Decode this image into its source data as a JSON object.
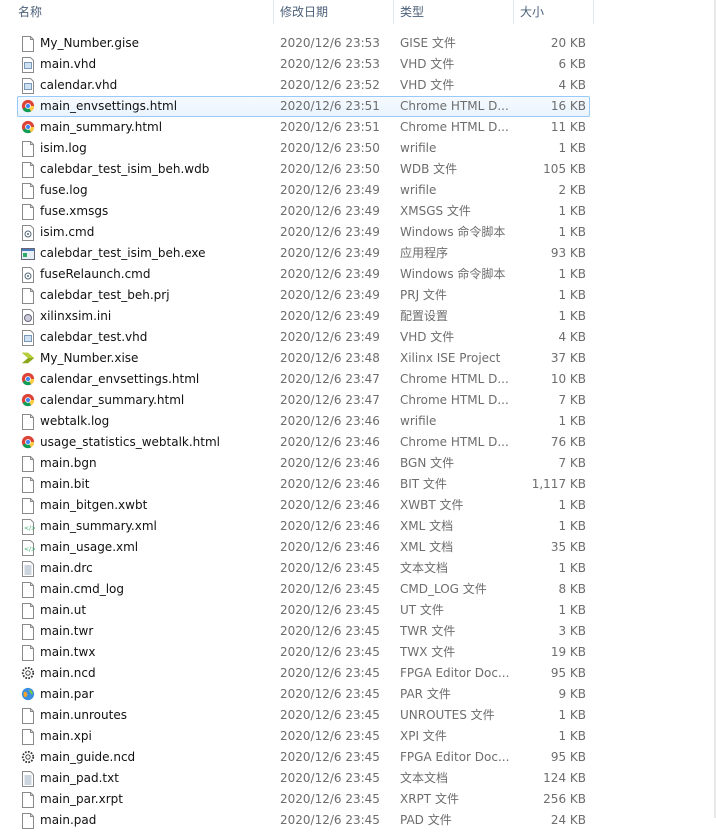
{
  "columns": {
    "name": "名称",
    "date": "修改日期",
    "type": "类型",
    "size": "大小"
  },
  "files": [
    {
      "name": "My_Number.gise",
      "date": "2020/12/6 23:53",
      "type": "GISE 文件",
      "size": "20 KB",
      "icon": "file"
    },
    {
      "name": "main.vhd",
      "date": "2020/12/6 23:53",
      "type": "VHD 文件",
      "size": "6 KB",
      "icon": "vhd"
    },
    {
      "name": "calendar.vhd",
      "date": "2020/12/6 23:52",
      "type": "VHD 文件",
      "size": "4 KB",
      "icon": "vhd"
    },
    {
      "name": "main_envsettings.html",
      "date": "2020/12/6 23:51",
      "type": "Chrome HTML D...",
      "size": "16 KB",
      "icon": "chrome",
      "selected": true
    },
    {
      "name": "main_summary.html",
      "date": "2020/12/6 23:51",
      "type": "Chrome HTML D...",
      "size": "11 KB",
      "icon": "chrome"
    },
    {
      "name": "isim.log",
      "date": "2020/12/6 23:50",
      "type": "wrifile",
      "size": "1 KB",
      "icon": "file"
    },
    {
      "name": "calebdar_test_isim_beh.wdb",
      "date": "2020/12/6 23:50",
      "type": "WDB 文件",
      "size": "105 KB",
      "icon": "file"
    },
    {
      "name": "fuse.log",
      "date": "2020/12/6 23:49",
      "type": "wrifile",
      "size": "2 KB",
      "icon": "file"
    },
    {
      "name": "fuse.xmsgs",
      "date": "2020/12/6 23:49",
      "type": "XMSGS 文件",
      "size": "1 KB",
      "icon": "file"
    },
    {
      "name": "isim.cmd",
      "date": "2020/12/6 23:49",
      "type": "Windows 命令脚本",
      "size": "1 KB",
      "icon": "cmd"
    },
    {
      "name": "calebdar_test_isim_beh.exe",
      "date": "2020/12/6 23:49",
      "type": "应用程序",
      "size": "93 KB",
      "icon": "exe"
    },
    {
      "name": "fuseRelaunch.cmd",
      "date": "2020/12/6 23:49",
      "type": "Windows 命令脚本",
      "size": "1 KB",
      "icon": "cmd"
    },
    {
      "name": "calebdar_test_beh.prj",
      "date": "2020/12/6 23:49",
      "type": "PRJ 文件",
      "size": "1 KB",
      "icon": "file"
    },
    {
      "name": "xilinxsim.ini",
      "date": "2020/12/6 23:49",
      "type": "配置设置",
      "size": "1 KB",
      "icon": "ini"
    },
    {
      "name": "calebdar_test.vhd",
      "date": "2020/12/6 23:49",
      "type": "VHD 文件",
      "size": "4 KB",
      "icon": "vhd"
    },
    {
      "name": "My_Number.xise",
      "date": "2020/12/6 23:48",
      "type": "Xilinx ISE Project",
      "size": "37 KB",
      "icon": "xise"
    },
    {
      "name": "calendar_envsettings.html",
      "date": "2020/12/6 23:47",
      "type": "Chrome HTML D...",
      "size": "10 KB",
      "icon": "chrome"
    },
    {
      "name": "calendar_summary.html",
      "date": "2020/12/6 23:47",
      "type": "Chrome HTML D...",
      "size": "7 KB",
      "icon": "chrome"
    },
    {
      "name": "webtalk.log",
      "date": "2020/12/6 23:46",
      "type": "wrifile",
      "size": "1 KB",
      "icon": "file"
    },
    {
      "name": "usage_statistics_webtalk.html",
      "date": "2020/12/6 23:46",
      "type": "Chrome HTML D...",
      "size": "76 KB",
      "icon": "chrome"
    },
    {
      "name": "main.bgn",
      "date": "2020/12/6 23:46",
      "type": "BGN 文件",
      "size": "7 KB",
      "icon": "file"
    },
    {
      "name": "main.bit",
      "date": "2020/12/6 23:46",
      "type": "BIT 文件",
      "size": "1,117 KB",
      "icon": "file"
    },
    {
      "name": "main_bitgen.xwbt",
      "date": "2020/12/6 23:46",
      "type": "XWBT 文件",
      "size": "1 KB",
      "icon": "file"
    },
    {
      "name": "main_summary.xml",
      "date": "2020/12/6 23:46",
      "type": "XML 文档",
      "size": "1 KB",
      "icon": "xml"
    },
    {
      "name": "main_usage.xml",
      "date": "2020/12/6 23:46",
      "type": "XML 文档",
      "size": "35 KB",
      "icon": "xml"
    },
    {
      "name": "main.drc",
      "date": "2020/12/6 23:45",
      "type": "文本文档",
      "size": "1 KB",
      "icon": "txt"
    },
    {
      "name": "main.cmd_log",
      "date": "2020/12/6 23:45",
      "type": "CMD_LOG 文件",
      "size": "8 KB",
      "icon": "file"
    },
    {
      "name": "main.ut",
      "date": "2020/12/6 23:45",
      "type": "UT 文件",
      "size": "1 KB",
      "icon": "file"
    },
    {
      "name": "main.twr",
      "date": "2020/12/6 23:45",
      "type": "TWR 文件",
      "size": "3 KB",
      "icon": "file"
    },
    {
      "name": "main.twx",
      "date": "2020/12/6 23:45",
      "type": "TWX 文件",
      "size": "19 KB",
      "icon": "file"
    },
    {
      "name": "main.ncd",
      "date": "2020/12/6 23:45",
      "type": "FPGA Editor Doc...",
      "size": "95 KB",
      "icon": "ncd"
    },
    {
      "name": "main.par",
      "date": "2020/12/6 23:45",
      "type": "PAR 文件",
      "size": "9 KB",
      "icon": "par"
    },
    {
      "name": "main.unroutes",
      "date": "2020/12/6 23:45",
      "type": "UNROUTES 文件",
      "size": "1 KB",
      "icon": "file"
    },
    {
      "name": "main.xpi",
      "date": "2020/12/6 23:45",
      "type": "XPI 文件",
      "size": "1 KB",
      "icon": "file"
    },
    {
      "name": "main_guide.ncd",
      "date": "2020/12/6 23:45",
      "type": "FPGA Editor Doc...",
      "size": "95 KB",
      "icon": "ncd"
    },
    {
      "name": "main_pad.txt",
      "date": "2020/12/6 23:45",
      "type": "文本文档",
      "size": "124 KB",
      "icon": "txt"
    },
    {
      "name": "main_par.xrpt",
      "date": "2020/12/6 23:45",
      "type": "XRPT 文件",
      "size": "256 KB",
      "icon": "file"
    },
    {
      "name": "main.pad",
      "date": "2020/12/6 23:45",
      "type": "PAD 文件",
      "size": "24 KB",
      "icon": "file"
    }
  ]
}
